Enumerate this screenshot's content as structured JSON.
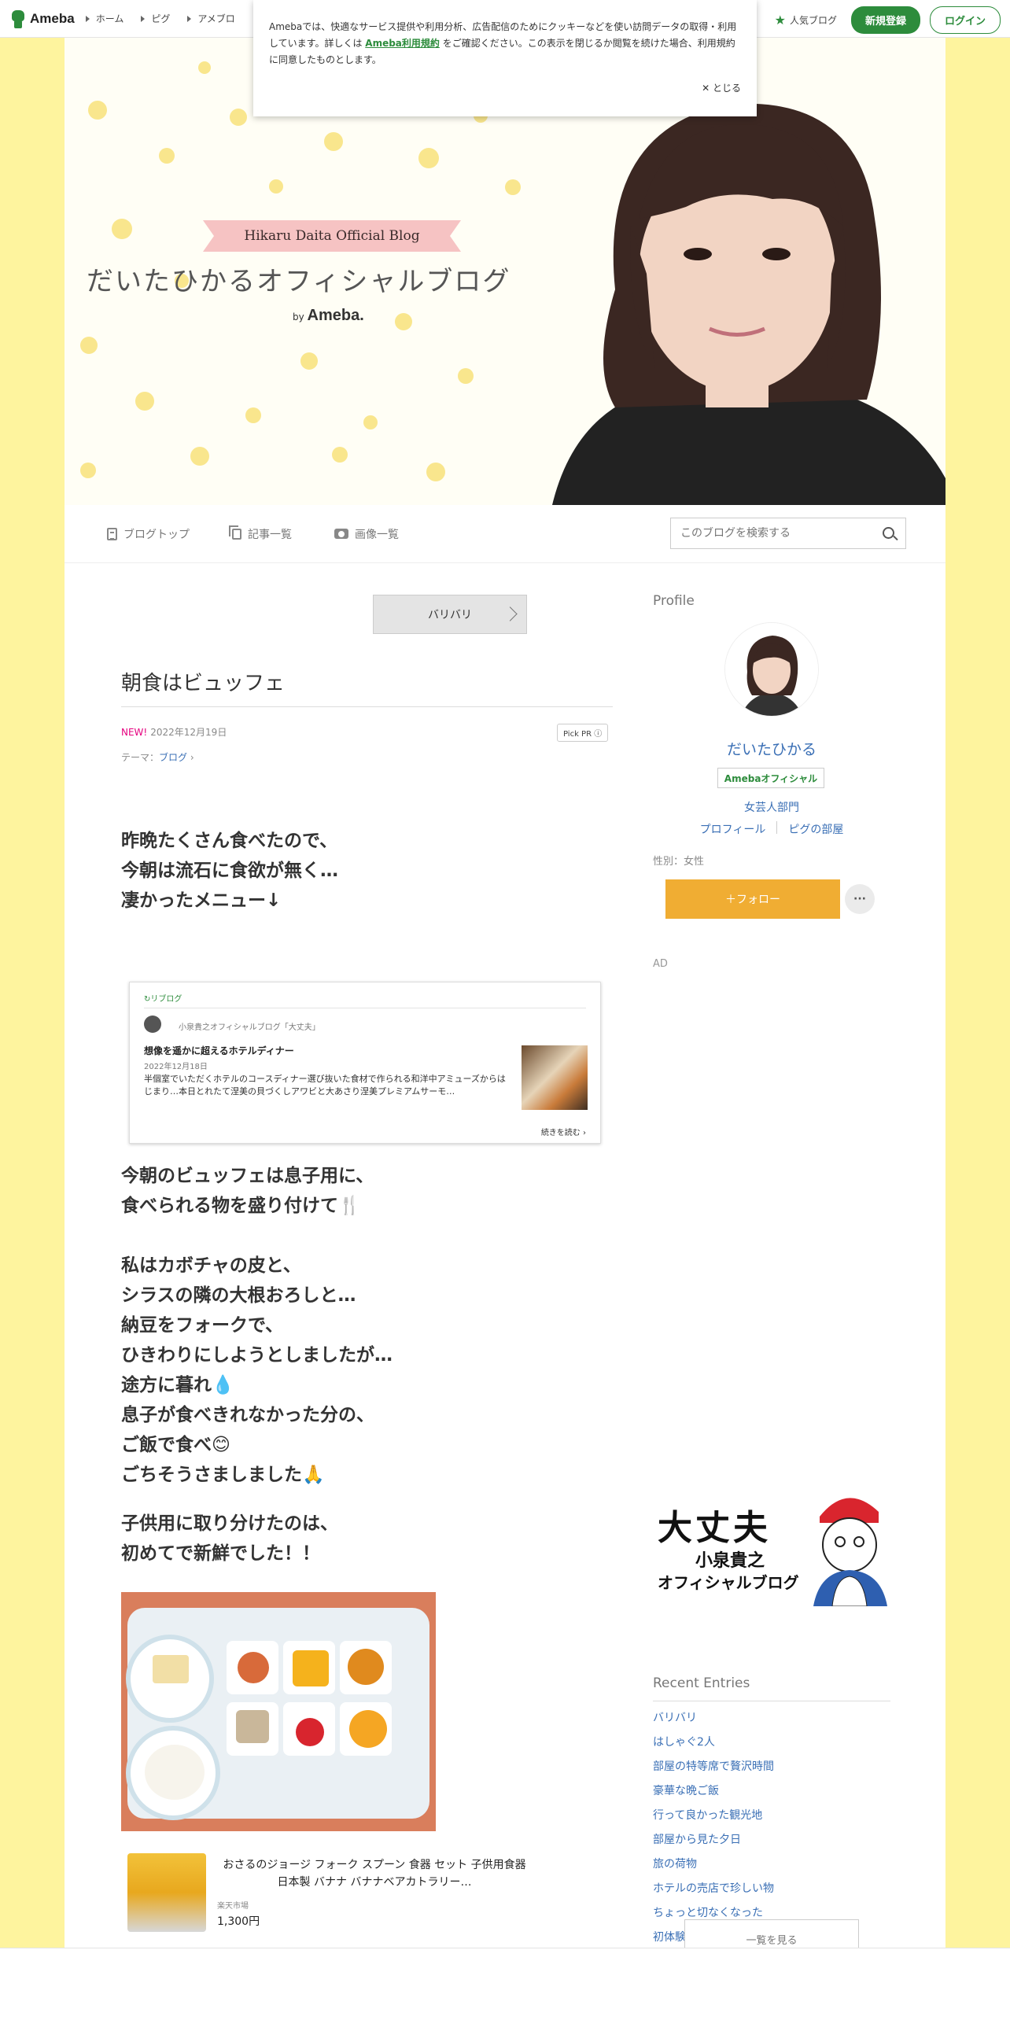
{
  "topbar": {
    "logo": "Ameba",
    "nav": [
      "ホーム",
      "ピグ",
      "アメブロ"
    ],
    "popular": "人気ブログ",
    "register": "新規登録",
    "login": "ログイン"
  },
  "cookie": {
    "text_before": "Amebaでは、快適なサービス提供や利用分析、広告配信のためにクッキーなどを使い訪問データの取得・利用しています。詳しくは",
    "link": "Ameba利用規約",
    "text_after": "をご確認ください。この表示を閉じるか閲覧を続けた場合、利用規約に同意したものとします。",
    "close": "とじる"
  },
  "header": {
    "ribbon": "Hikaru Daita Official Blog",
    "title": "だいたひかるオフィシャルブログ",
    "by": "by",
    "brand": "Ameba."
  },
  "blognav": {
    "items": [
      "ブログトップ",
      "記事一覧",
      "画像一覧"
    ],
    "search_placeholder": "このブログを検索する"
  },
  "article": {
    "reblog_button": "バリバリ",
    "title": "朝食はビュッフェ",
    "new": "NEW!",
    "date": "2022年12月19日",
    "pickpr": "Pick PR ⓘ",
    "theme_label": "テーマ：",
    "theme": "ブログ",
    "para1": [
      "昨晩たくさん食べたので、",
      "今朝は流石に食欲が無く…",
      "凄かったメニュー↓"
    ],
    "para2": [
      "今朝のビュッフェは息子用に、",
      "食べられる物を盛り付けて🍴",
      "",
      "私はカボチャの皮と、",
      "シラスの隣の大根おろしと…",
      "納豆をフォークで、",
      "ひきわりにしようとしましたが…",
      "途方に暮れ💧",
      "息子が食べきれなかった分の、",
      "ご飯で食べ😊",
      "ごちそうさましました🙏"
    ],
    "para3": [
      "子供用に取り分けたのは、",
      "初めてで新鮮でした！！"
    ]
  },
  "reblog_card": {
    "label": "リブログ",
    "source": "小泉貴之オフィシャルブログ「大丈夫」",
    "title": "想像を遥かに超えるホテルディナー",
    "date": "2022年12月18日",
    "desc": "半個室でいただくホテルのコースディナー選び抜いた食材で作られる和洋中アミューズからはじまり…本日とれたて涅美の貝づくしアワビと大あさり涅美プレミアムサーモ…",
    "more": "続きを読む"
  },
  "product": {
    "name": "おさるのジョージ フォーク スプーン 食器 セット 子供用食器 日本製 バナナ バナナベアカトラリー…",
    "shop": "楽天市場",
    "price": "1,300円"
  },
  "sidebar": {
    "profile_heading": "Profile",
    "name": "だいたひかる",
    "badge": "Amebaオフィシャル",
    "category": "女芸人部門",
    "link_profile": "プロフィール",
    "link_pig": "ピグの部屋",
    "gender": "性別：女性",
    "follow": "＋フォロー",
    "more": "···",
    "ad": "AD",
    "banner_title": "大丈夫",
    "banner_name": "小泉貴之",
    "banner_sub": "オフィシャルブログ",
    "recent_heading": "Recent Entries",
    "entries": [
      "バリバリ",
      "はしゃぐ2人",
      "部屋の特等席で贅沢時間",
      "豪華な晩ご飯",
      "行って良かった観光地",
      "部屋から見た夕日",
      "旅の荷物",
      "ホテルの売店で珍しい物",
      "ちょっと切なくなった",
      "初体験の感覚"
    ],
    "see_all": "一覧を見る"
  },
  "colors": {
    "brand_green": "#2d8c3c",
    "follow_orange": "#f0ad33",
    "side_yellow": "#fef49e",
    "link_blue": "#3a6fb5"
  }
}
